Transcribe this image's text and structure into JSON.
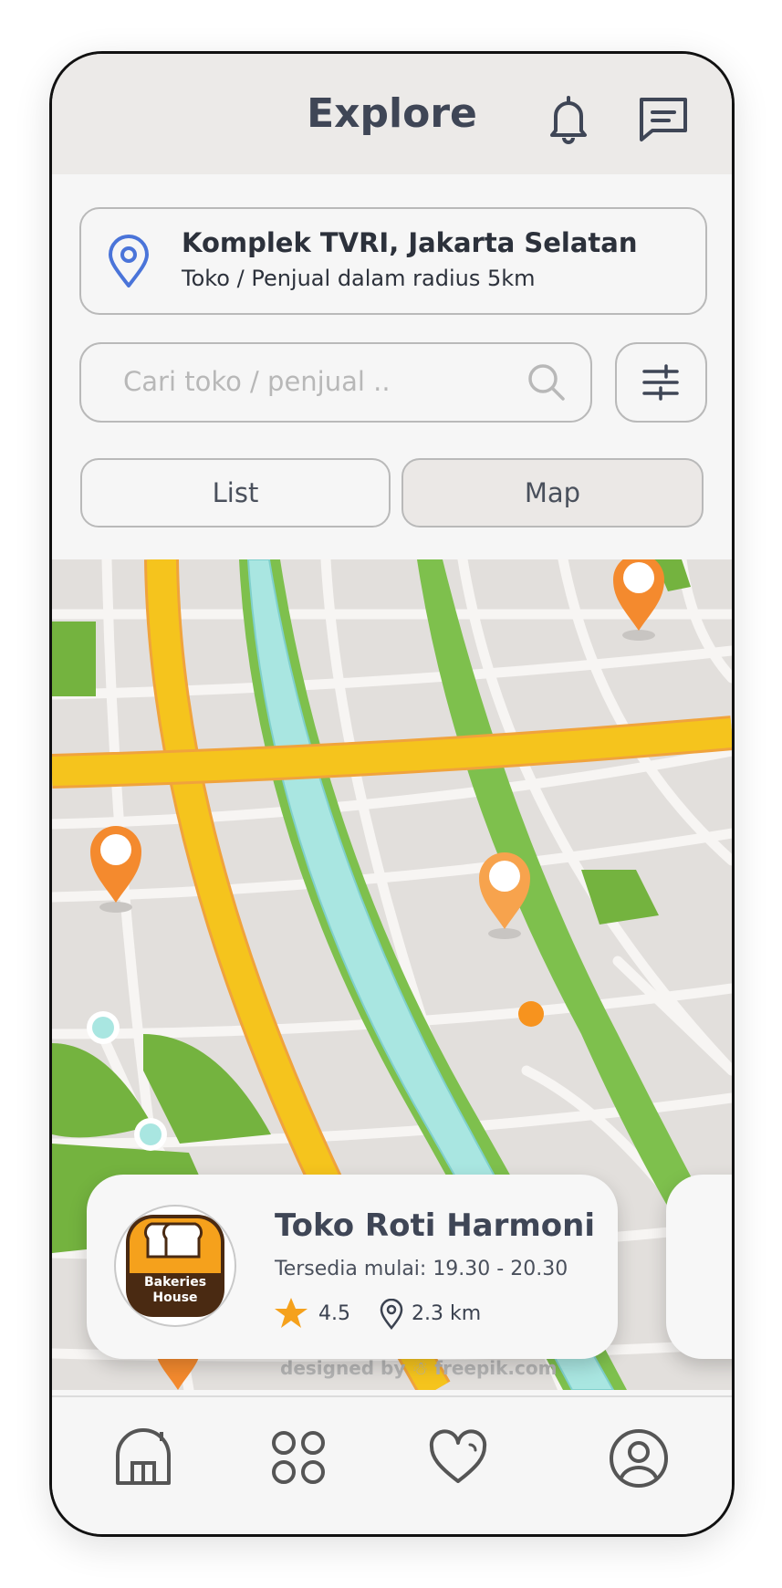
{
  "header": {
    "title": "Explore",
    "notification_icon": "bell-icon",
    "message_icon": "message-icon"
  },
  "location": {
    "title": "Komplek TVRI, Jakarta Selatan",
    "subtitle": "Toko / Penjual dalam radius 5km",
    "icon": "location-pin-icon",
    "accent": "#4a74d9"
  },
  "search": {
    "placeholder": "Cari toko / penjual ..",
    "value": ""
  },
  "view_tabs": {
    "list_label": "List",
    "map_label": "Map",
    "selected": "Map"
  },
  "store_card": {
    "name": "Toko Roti Harmoni",
    "availability": "Tersedia mulai: 19.30 - 20.30",
    "rating": "4.5",
    "distance": "2.3 km",
    "logo_text_line1": "Bakeries",
    "logo_text_line2": "House"
  },
  "map": {
    "credit": "designed by ☃ freepik.com",
    "road_color": "#f5c41d",
    "park_color": "#72b13f",
    "river_color": "#9fe3df",
    "pin_color": "#f48a2e"
  },
  "bottom_nav": {
    "items": [
      "home-icon",
      "categories-icon",
      "favorites-icon",
      "profile-icon"
    ]
  }
}
